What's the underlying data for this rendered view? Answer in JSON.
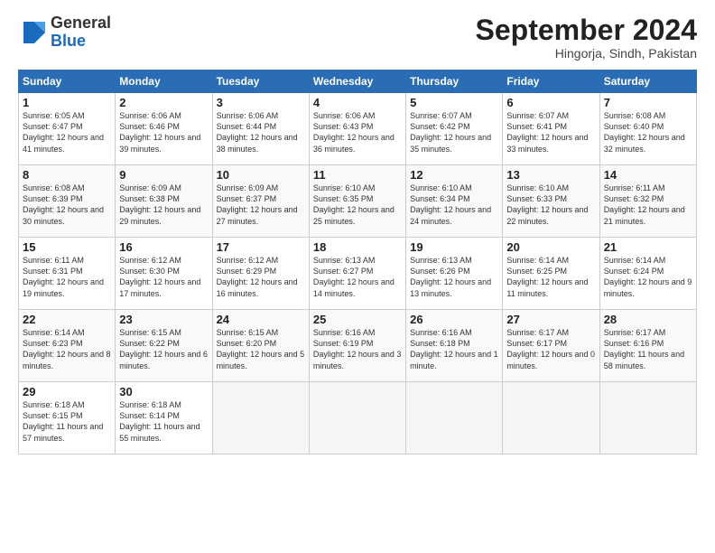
{
  "header": {
    "logo": {
      "general": "General",
      "blue": "Blue"
    },
    "title": "September 2024",
    "location": "Hingorja, Sindh, Pakistan"
  },
  "weekdays": [
    "Sunday",
    "Monday",
    "Tuesday",
    "Wednesday",
    "Thursday",
    "Friday",
    "Saturday"
  ],
  "weeks": [
    [
      {
        "day": 1,
        "sunrise": "6:05 AM",
        "sunset": "6:47 PM",
        "daylight": "12 hours and 41 minutes."
      },
      {
        "day": 2,
        "sunrise": "6:06 AM",
        "sunset": "6:46 PM",
        "daylight": "12 hours and 39 minutes."
      },
      {
        "day": 3,
        "sunrise": "6:06 AM",
        "sunset": "6:44 PM",
        "daylight": "12 hours and 38 minutes."
      },
      {
        "day": 4,
        "sunrise": "6:06 AM",
        "sunset": "6:43 PM",
        "daylight": "12 hours and 36 minutes."
      },
      {
        "day": 5,
        "sunrise": "6:07 AM",
        "sunset": "6:42 PM",
        "daylight": "12 hours and 35 minutes."
      },
      {
        "day": 6,
        "sunrise": "6:07 AM",
        "sunset": "6:41 PM",
        "daylight": "12 hours and 33 minutes."
      },
      {
        "day": 7,
        "sunrise": "6:08 AM",
        "sunset": "6:40 PM",
        "daylight": "12 hours and 32 minutes."
      }
    ],
    [
      {
        "day": 8,
        "sunrise": "6:08 AM",
        "sunset": "6:39 PM",
        "daylight": "12 hours and 30 minutes."
      },
      {
        "day": 9,
        "sunrise": "6:09 AM",
        "sunset": "6:38 PM",
        "daylight": "12 hours and 29 minutes."
      },
      {
        "day": 10,
        "sunrise": "6:09 AM",
        "sunset": "6:37 PM",
        "daylight": "12 hours and 27 minutes."
      },
      {
        "day": 11,
        "sunrise": "6:10 AM",
        "sunset": "6:35 PM",
        "daylight": "12 hours and 25 minutes."
      },
      {
        "day": 12,
        "sunrise": "6:10 AM",
        "sunset": "6:34 PM",
        "daylight": "12 hours and 24 minutes."
      },
      {
        "day": 13,
        "sunrise": "6:10 AM",
        "sunset": "6:33 PM",
        "daylight": "12 hours and 22 minutes."
      },
      {
        "day": 14,
        "sunrise": "6:11 AM",
        "sunset": "6:32 PM",
        "daylight": "12 hours and 21 minutes."
      }
    ],
    [
      {
        "day": 15,
        "sunrise": "6:11 AM",
        "sunset": "6:31 PM",
        "daylight": "12 hours and 19 minutes."
      },
      {
        "day": 16,
        "sunrise": "6:12 AM",
        "sunset": "6:30 PM",
        "daylight": "12 hours and 17 minutes."
      },
      {
        "day": 17,
        "sunrise": "6:12 AM",
        "sunset": "6:29 PM",
        "daylight": "12 hours and 16 minutes."
      },
      {
        "day": 18,
        "sunrise": "6:13 AM",
        "sunset": "6:27 PM",
        "daylight": "12 hours and 14 minutes."
      },
      {
        "day": 19,
        "sunrise": "6:13 AM",
        "sunset": "6:26 PM",
        "daylight": "12 hours and 13 minutes."
      },
      {
        "day": 20,
        "sunrise": "6:14 AM",
        "sunset": "6:25 PM",
        "daylight": "12 hours and 11 minutes."
      },
      {
        "day": 21,
        "sunrise": "6:14 AM",
        "sunset": "6:24 PM",
        "daylight": "12 hours and 9 minutes."
      }
    ],
    [
      {
        "day": 22,
        "sunrise": "6:14 AM",
        "sunset": "6:23 PM",
        "daylight": "12 hours and 8 minutes."
      },
      {
        "day": 23,
        "sunrise": "6:15 AM",
        "sunset": "6:22 PM",
        "daylight": "12 hours and 6 minutes."
      },
      {
        "day": 24,
        "sunrise": "6:15 AM",
        "sunset": "6:20 PM",
        "daylight": "12 hours and 5 minutes."
      },
      {
        "day": 25,
        "sunrise": "6:16 AM",
        "sunset": "6:19 PM",
        "daylight": "12 hours and 3 minutes."
      },
      {
        "day": 26,
        "sunrise": "6:16 AM",
        "sunset": "6:18 PM",
        "daylight": "12 hours and 1 minute."
      },
      {
        "day": 27,
        "sunrise": "6:17 AM",
        "sunset": "6:17 PM",
        "daylight": "12 hours and 0 minutes."
      },
      {
        "day": 28,
        "sunrise": "6:17 AM",
        "sunset": "6:16 PM",
        "daylight": "11 hours and 58 minutes."
      }
    ],
    [
      {
        "day": 29,
        "sunrise": "6:18 AM",
        "sunset": "6:15 PM",
        "daylight": "11 hours and 57 minutes."
      },
      {
        "day": 30,
        "sunrise": "6:18 AM",
        "sunset": "6:14 PM",
        "daylight": "11 hours and 55 minutes."
      },
      null,
      null,
      null,
      null,
      null
    ]
  ]
}
